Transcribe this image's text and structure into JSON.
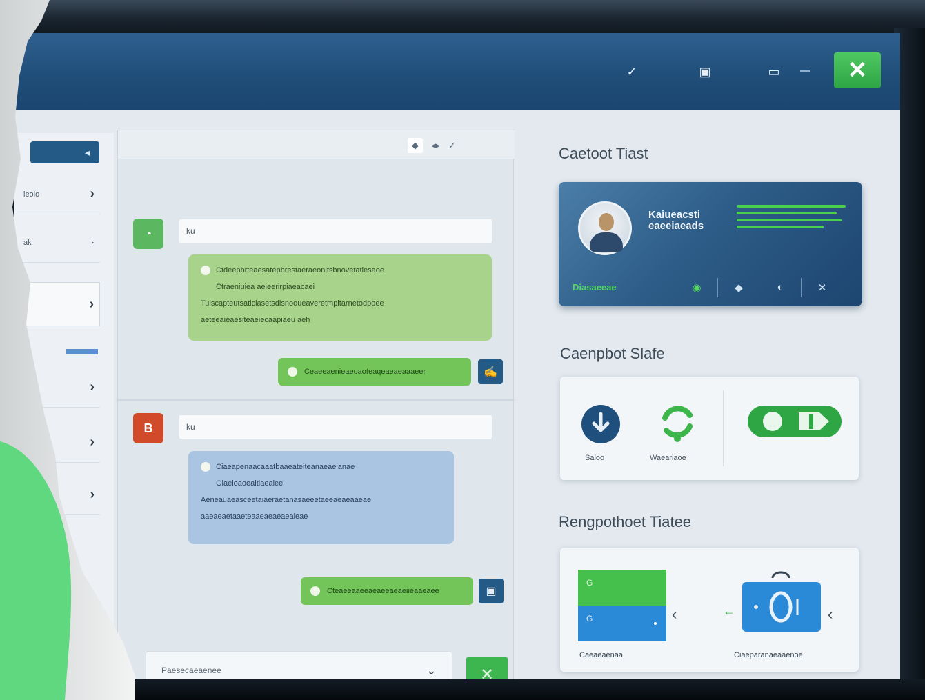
{
  "titlebar": {
    "buttons": [
      {
        "icon": "mark-icon",
        "glyph": "✓"
      },
      {
        "icon": "window-icon",
        "glyph": "▣"
      },
      {
        "icon": "screen-icon",
        "glyph": "▭"
      }
    ],
    "close_glyph": "✕"
  },
  "sidebar": {
    "header_glyph": "◂",
    "items": [
      {
        "label": "ieoio",
        "chev": "›"
      },
      {
        "label": "ak",
        "chev": "›"
      },
      {
        "label": "",
        "chev": "›"
      },
      {
        "label": "",
        "chev": "›"
      },
      {
        "label": "",
        "chev": "›"
      },
      {
        "label": "",
        "chev": "›"
      }
    ]
  },
  "chat": {
    "header_controls": [
      "◆",
      "◂▸",
      "✓"
    ],
    "messages": [
      {
        "avatar_glyph": "◔",
        "name": "ku",
        "lines": [
          "Ctdeepbrteaesatepbrestaeraeonitsbnovetatiesaoe",
          "Ctraeniuiea aeieerirpiaeacaei",
          "Tuiscapteutsaticiasetsdisnooueaveretmpitarnetodpoee",
          "aeteeaieaesiteaeiecaapiaeu aeh"
        ],
        "reply": "Ceaeeaenieaeoaoteaqeaeaeaaaeer",
        "reply_icon": "✍"
      },
      {
        "avatar_glyph": "B",
        "name": "ku",
        "lines": [
          "Ciaeapenaacaaatbaaeateiteanaeaeianae",
          "Giaeioaoeaitiaeaiee",
          "Aeneauaeasceetaiaeraetanasaeeetaeeaeaeaaeae",
          "aaeaeaetaaeteaaeaeaeaeaieae"
        ],
        "reply": "Cteaeeaaeeaeaeeaeaeiieaaeaee",
        "reply_icon": "▣"
      }
    ],
    "input_placeholder": "Paesecaeaenee",
    "input_caret": "⌄",
    "send_glyph": "✕"
  },
  "right": {
    "agent_title": "Caetoot Tiast",
    "agent": {
      "name_line1": "Kaiueacsti",
      "name_line2": "eaeeiaeads",
      "footer_label": "Diasaeeae",
      "footer_controls": [
        "◉",
        "◆",
        "◐",
        "✕"
      ]
    },
    "status_title": "Caenpbot Slafe",
    "status": [
      {
        "icon": "download-icon",
        "label": "Saloo"
      },
      {
        "icon": "sync-icon",
        "label": "Waeariaoe"
      },
      {
        "icon": "toggle-icon",
        "label": ""
      }
    ],
    "response_title": "Rengpothoet Tiatee",
    "templates": [
      {
        "top": "G",
        "bottom": "G",
        "label": "Caeaeaenaa"
      },
      {
        "label": "Ciaeparanaeaaenoe"
      }
    ]
  },
  "colors": {
    "titlebar": "#1f4d78",
    "accent_green": "#3db650",
    "accent_blue": "#245a86",
    "bubble_green": "#a7d38a",
    "bubble_blue": "#a9c5e2"
  }
}
